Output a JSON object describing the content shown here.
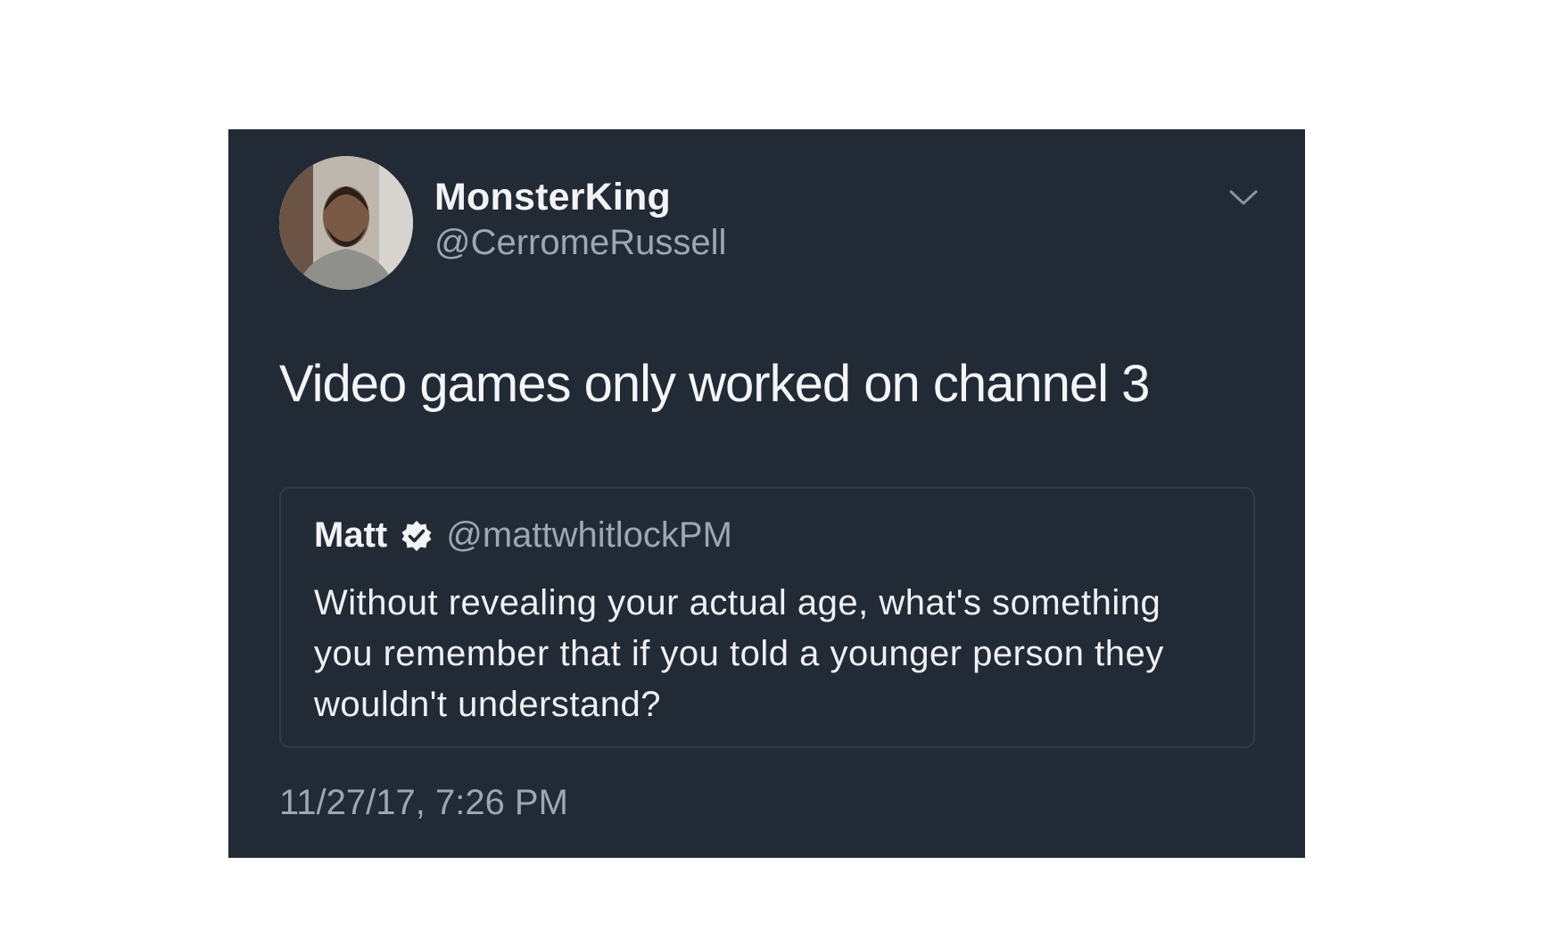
{
  "tweet": {
    "display_name": "MonsterKing",
    "handle": "@CerromeRussell",
    "text": "Video games only worked on channel 3",
    "timestamp": "11/27/17, 7:26 PM",
    "menu_icon": "chevron-down-icon"
  },
  "quoted_tweet": {
    "display_name": "Matt",
    "verified_icon": "verified-badge-icon",
    "handle": "@mattwhitlockPM",
    "text": "Without revealing your actual age, what's something you remember that if you told a younger person they wouldn't understand?"
  },
  "colors": {
    "page_background": "#ffffff",
    "card_background": "#222a36",
    "primary_text": "#f2f3f5",
    "secondary_text": "#9ea6b2",
    "quote_border": "#313a47"
  }
}
